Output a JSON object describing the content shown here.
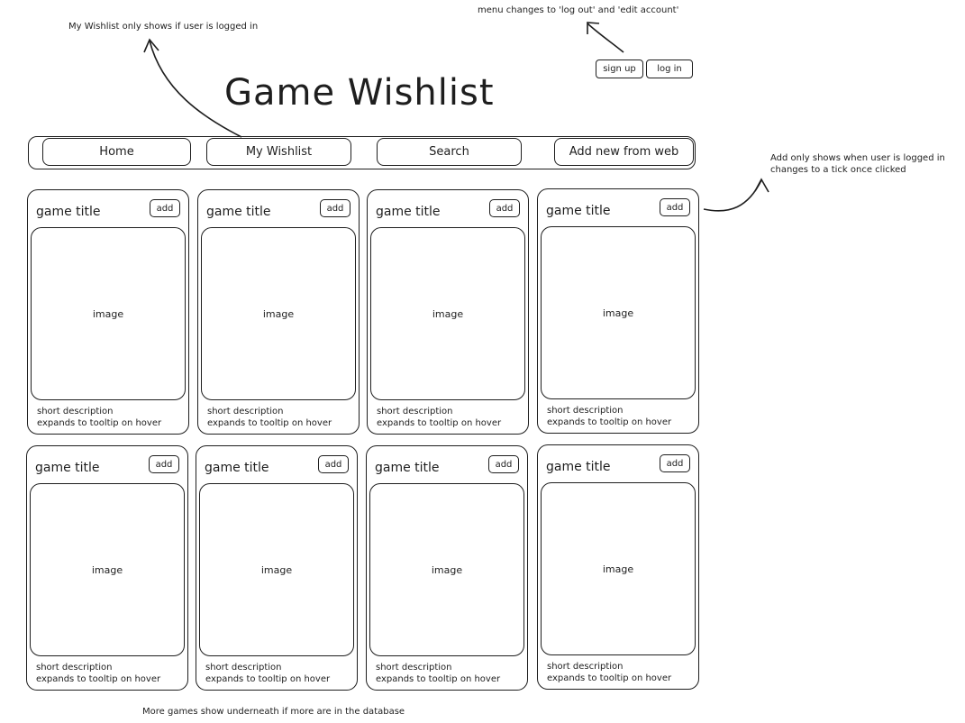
{
  "annotations": {
    "wishlist_note": "My Wishlist only shows if user is logged in",
    "menu_note": "menu changes to 'log out' and 'edit account'",
    "add_note_line1": "Add only shows when user is logged in",
    "add_note_line2": "changes to a tick once clicked",
    "footer_note": "More games show underneath if more are in the database"
  },
  "auth": {
    "signup_label": "sign up",
    "login_label": "log in"
  },
  "page_title": "Game Wishlist",
  "nav": {
    "home": "Home",
    "wishlist": "My Wishlist",
    "search": "Search",
    "add_from_web": "Add new from web"
  },
  "cards": [
    {
      "title": "game title",
      "add": "add",
      "image": "image",
      "desc1": "short description",
      "desc2": "expands to tooltip on hover"
    },
    {
      "title": "game title",
      "add": "add",
      "image": "image",
      "desc1": "short description",
      "desc2": "expands to tooltip on hover"
    },
    {
      "title": "game title",
      "add": "add",
      "image": "image",
      "desc1": "short description",
      "desc2": "expands to tooltip on hover"
    },
    {
      "title": "game title",
      "add": "add",
      "image": "image",
      "desc1": "short description",
      "desc2": "expands to tooltip on hover"
    },
    {
      "title": "game title",
      "add": "add",
      "image": "image",
      "desc1": "short description",
      "desc2": "expands to tooltip on hover"
    },
    {
      "title": "game title",
      "add": "add",
      "image": "image",
      "desc1": "short description",
      "desc2": "expands to tooltip on hover"
    },
    {
      "title": "game title",
      "add": "add",
      "image": "image",
      "desc1": "short description",
      "desc2": "expands to tooltip on hover"
    },
    {
      "title": "game title",
      "add": "add",
      "image": "image",
      "desc1": "short description",
      "desc2": "expands to tooltip on hover"
    }
  ]
}
